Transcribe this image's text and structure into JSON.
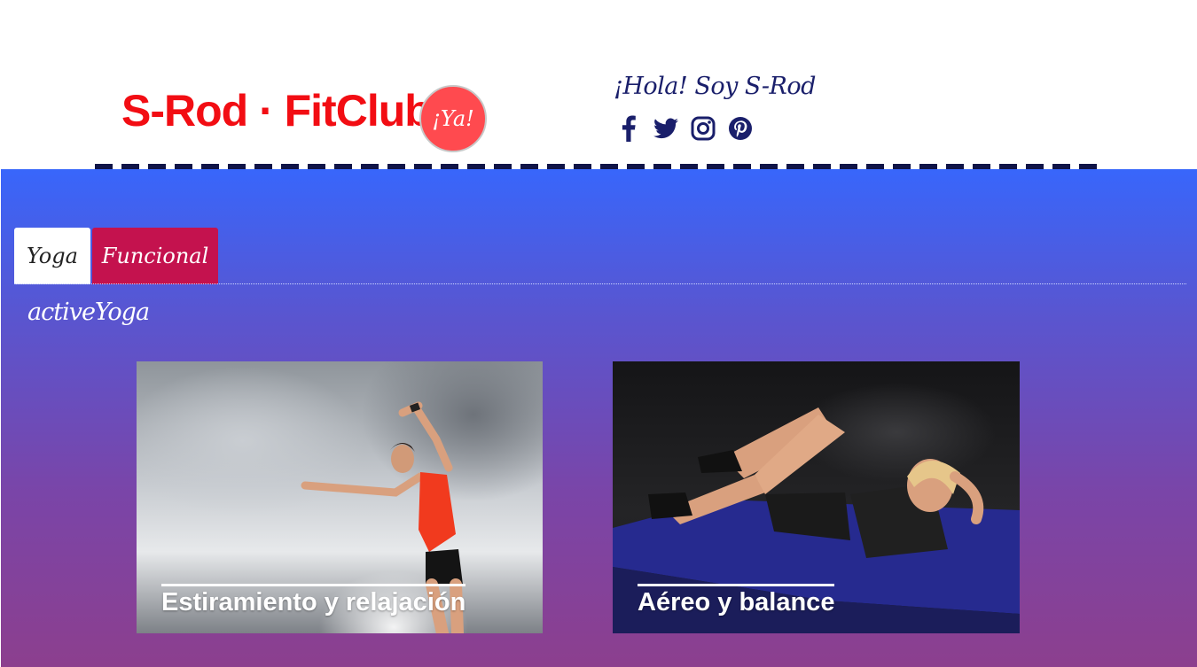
{
  "header": {
    "brand": "S-Rod · FitClub",
    "cta_label": "¡Ya!",
    "greeting": "¡Hola! Soy S-Rod",
    "social": [
      {
        "icon": "facebook-icon"
      },
      {
        "icon": "twitter-icon"
      },
      {
        "icon": "instagram-icon"
      },
      {
        "icon": "pinterest-icon"
      }
    ]
  },
  "tabs": [
    {
      "label": "Yoga",
      "active": true
    },
    {
      "label": "Funcional",
      "active": false
    }
  ],
  "pane": {
    "title": "activeYoga"
  },
  "cards": [
    {
      "caption": "Estiramiento y relajación",
      "image": "woman-stretching-sky-photo"
    },
    {
      "caption": "Aéreo y balance",
      "image": "woman-doing-crunches-mat-photo"
    }
  ],
  "colors": {
    "brand": "#f20d13",
    "cta": "#ff4a4f",
    "greeting": "#1a1f6b",
    "tab_active_bg": "#ffffff",
    "tab_inactive_bg": "#c4124e",
    "gradient_top": "#3866fb",
    "gradient_bottom": "#8c3f8e"
  }
}
